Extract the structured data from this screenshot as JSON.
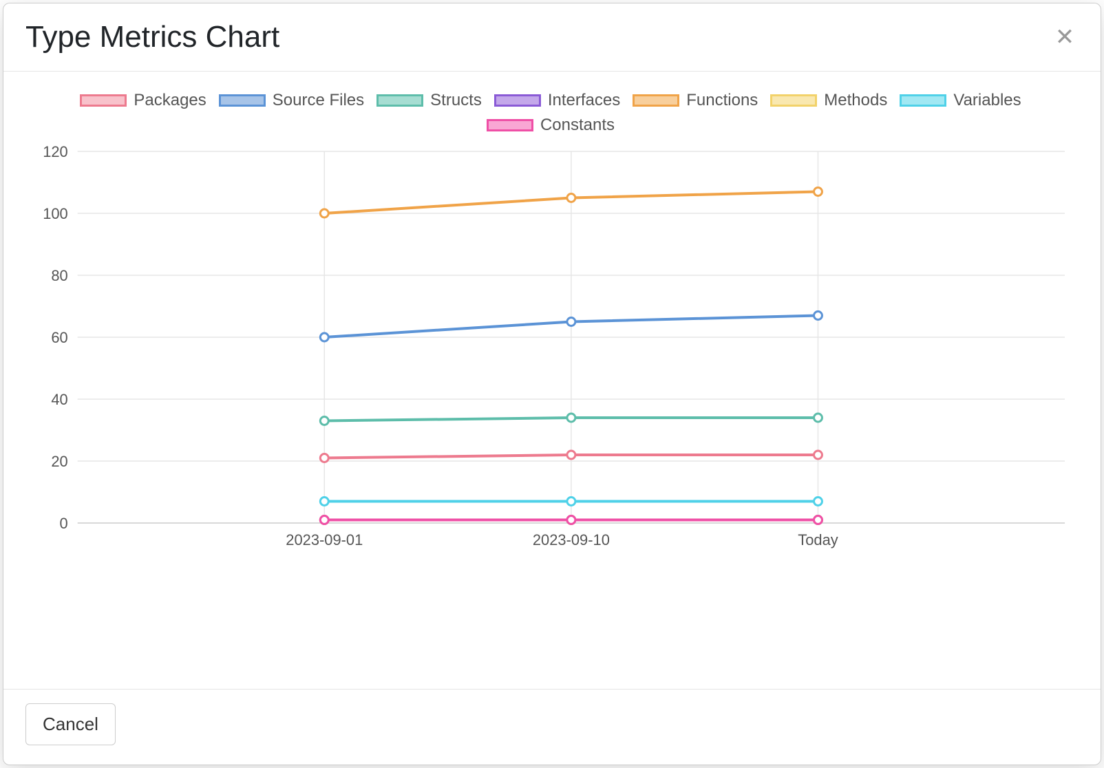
{
  "modal": {
    "title": "Type Metrics Chart",
    "footer": {
      "cancel_label": "Cancel"
    }
  },
  "chart_data": {
    "type": "line",
    "title": "",
    "xlabel": "",
    "ylabel": "",
    "ylim": [
      0,
      120
    ],
    "yticks": [
      0,
      20,
      40,
      60,
      80,
      100,
      120
    ],
    "categories": [
      "2023-09-01",
      "2023-09-10",
      "Today"
    ],
    "legend_position": "top",
    "grid": true,
    "series": [
      {
        "name": "Packages",
        "color": "#ed7a8e",
        "fill": "#f8c2cb",
        "values": [
          21,
          22,
          22
        ]
      },
      {
        "name": "Source Files",
        "color": "#5b93d6",
        "fill": "#a7c4e8",
        "values": [
          60,
          65,
          67
        ]
      },
      {
        "name": "Structs",
        "color": "#5dbdaa",
        "fill": "#a6ddd2",
        "values": [
          33,
          34,
          34
        ]
      },
      {
        "name": "Interfaces",
        "color": "#8a5ad6",
        "fill": "#c4a8ea",
        "values": [
          1,
          1,
          1
        ]
      },
      {
        "name": "Functions",
        "color": "#f0a348",
        "fill": "#f8cf9c",
        "values": [
          100,
          105,
          107
        ]
      },
      {
        "name": "Methods",
        "color": "#f2d26a",
        "fill": "#f9e8b0",
        "values": [
          1,
          1,
          1
        ]
      },
      {
        "name": "Variables",
        "color": "#4fd1e8",
        "fill": "#a1e8f3",
        "values": [
          7,
          7,
          7
        ]
      },
      {
        "name": "Constants",
        "color": "#ef4fa6",
        "fill": "#f9a6d4",
        "values": [
          1,
          1,
          1
        ]
      }
    ]
  }
}
